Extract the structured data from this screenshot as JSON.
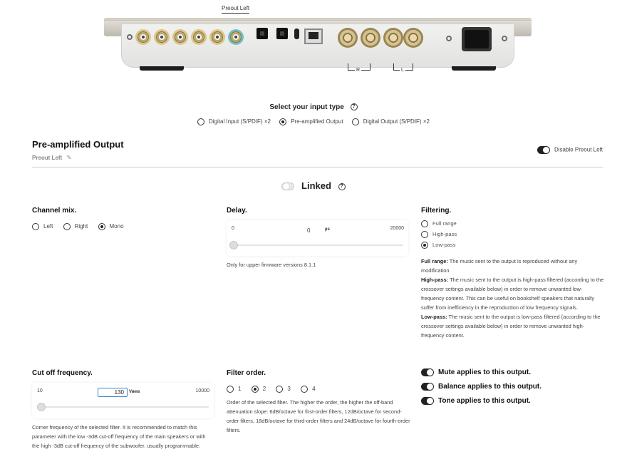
{
  "device": {
    "caption": "Preout Left",
    "bracket_right": "R",
    "bracket_left": "L"
  },
  "input_type": {
    "title": "Select your input type",
    "help_icon": "question-circle-icon",
    "options": [
      {
        "label": "Digital Input (S/PDIF) ×2",
        "selected": false
      },
      {
        "label": "Pre-amplified Output",
        "selected": true
      },
      {
        "label": "Digital Output (S/PDIF) ×2",
        "selected": false
      }
    ]
  },
  "section": {
    "title": "Pre-amplified Output",
    "subtitle": "Preout Left",
    "disable_label": "Disable Preout Left",
    "disable_on": true
  },
  "linked": {
    "label": "Linked",
    "on": false
  },
  "channel_mix": {
    "title": "Channel mix.",
    "options": [
      {
        "label": "Left",
        "selected": false
      },
      {
        "label": "Right",
        "selected": false
      },
      {
        "label": "Mono",
        "selected": true
      }
    ]
  },
  "delay": {
    "title": "Delay.",
    "min": "0",
    "max": "20000",
    "value": "0",
    "unit": "µs",
    "level": 0,
    "note": "Only for upper firmware versions 8.1.1"
  },
  "filtering": {
    "title": "Filtering.",
    "options": [
      {
        "label": "Full range",
        "selected": false
      },
      {
        "label": "High-pass",
        "selected": false
      },
      {
        "label": "Low-pass",
        "selected": true
      }
    ],
    "desc_full_label": "Full range:",
    "desc_full_text": " The music sent to the output is reproduced without any modification.",
    "desc_high_label": "High-pass:",
    "desc_high_text": " The music sent to the output is high-pass filtered (according to the crossover settings available below) in order to remove unwanted low-frequency content. This can be useful on bookshelf speakers that naturally suffer from inefficiency in the reproduction of low frequency signals.",
    "desc_low_label": "Low-pass:",
    "desc_low_text": " The music sent to the output is low-pass filtered (according to the crossover settings available below) in order to remove unwanted high-frequency content."
  },
  "cutoff": {
    "title": "Cut off frequency.",
    "min": "10",
    "max": "10000",
    "value": "130",
    "unit": "Vᴃᴍs",
    "level": 0.012,
    "note": "Corner frequency of the selected filter. It is recommended to match this parameter with the low -3dB cut-off frequency of the main speakers or with the high -3dB cut-off frequency of the subwoofer, usually programmable."
  },
  "filter_order": {
    "title": "Filter order.",
    "options": [
      {
        "label": "1",
        "selected": false
      },
      {
        "label": "2",
        "selected": true
      },
      {
        "label": "3",
        "selected": false
      },
      {
        "label": "4",
        "selected": false
      }
    ],
    "note": "Order of the selected filter. The higher the order, the higher the off-band attenuation slope: 6dB/octave for first-order filters, 12dB/octave for second-order filters, 18dB/octave for third-order filters and 24dB/octave for fourth-order filters."
  },
  "toggles": [
    {
      "label": "Mute applies to this output.",
      "on": true
    },
    {
      "label": "Balance applies to this output.",
      "on": true
    },
    {
      "label": "Tone applies to this output.",
      "on": true
    }
  ]
}
